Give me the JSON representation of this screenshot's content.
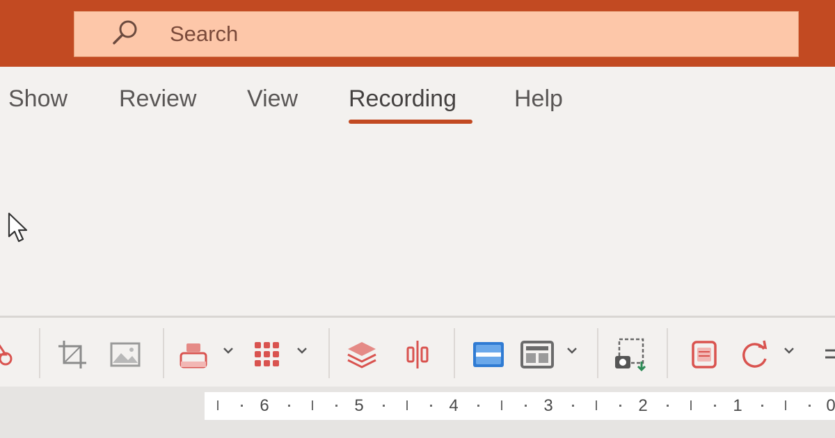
{
  "search": {
    "placeholder": "Search"
  },
  "tabs": [
    {
      "label": "Show"
    },
    {
      "label": "Review"
    },
    {
      "label": "View"
    },
    {
      "label": "Recording",
      "active": true
    },
    {
      "label": "Help"
    }
  ],
  "ruler": {
    "numbers": [
      "6",
      "5",
      "4",
      "3",
      "2",
      "1",
      "0"
    ]
  },
  "colors": {
    "titlebar": "#c24a22",
    "search_bg": "#fdc7a9",
    "ribbon_bg": "#f3f1ef",
    "accent": "#c24a22",
    "icon_red": "#d9534f",
    "icon_blue": "#2f7bd3"
  },
  "toolbar_icons": [
    "shapes-icon",
    "crop-icon",
    "picture-icon",
    "fill-icon",
    "dot-grid-icon",
    "layers-icon",
    "align-icon",
    "blue-panel-icon",
    "layout-icon",
    "screenshot-icon",
    "notes-icon",
    "refresh-icon",
    "more-icon"
  ]
}
